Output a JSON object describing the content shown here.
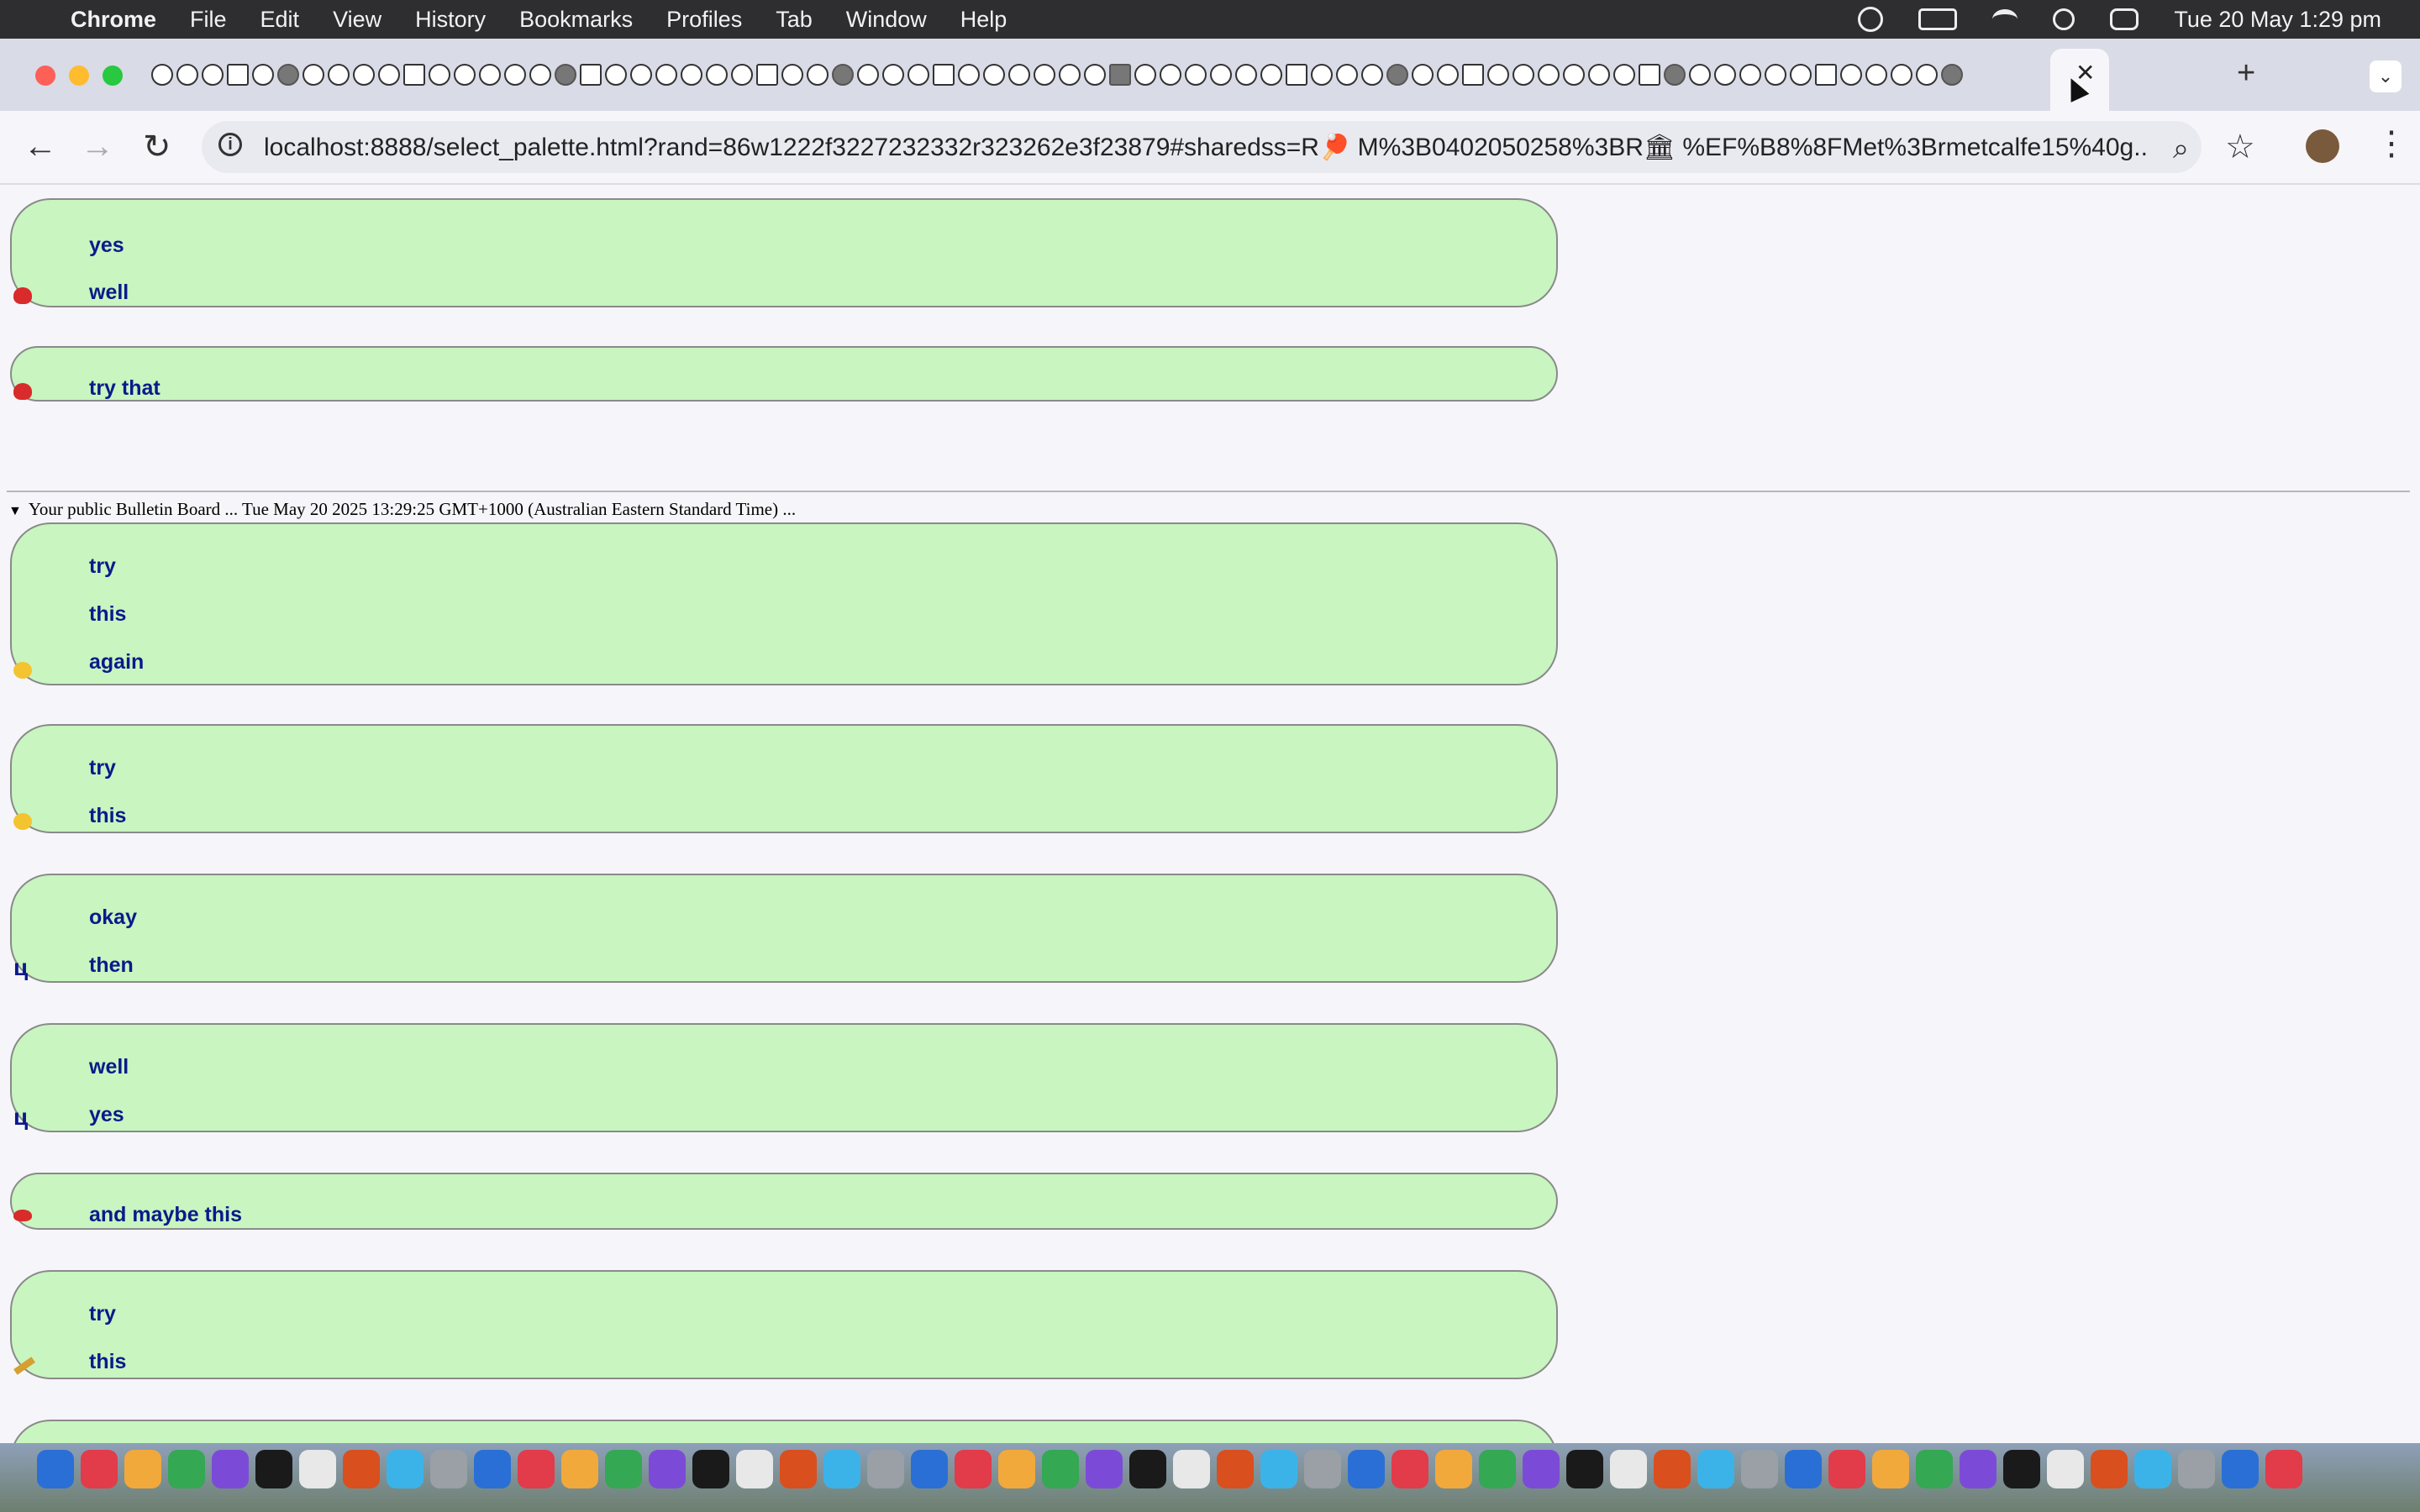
{
  "menubar": {
    "apple": "",
    "app": "Chrome",
    "items": [
      "File",
      "Edit",
      "View",
      "History",
      "Bookmarks",
      "Profiles",
      "Tab",
      "Window",
      "Help"
    ],
    "clock": "Tue 20 May  1:29 pm"
  },
  "tabstrip": {
    "close_glyph": "✕",
    "new_tab_glyph": "+",
    "tab_list_glyph": "⌄"
  },
  "toolbar": {
    "back": "←",
    "forward": "→",
    "reload": "↻",
    "info": "i",
    "url": "localhost:8888/select_palette.html?rand=86w1222f3227232332r323262e3f23879#sharedss=R🏓 M%3B0402050258%3BR🏛 %EF%B8%8FMet%3Brmetcalfe15%40g...",
    "zoom": "⌕",
    "star": "☆",
    "menu": "⋮"
  },
  "page": {
    "top_messages": [
      {
        "lines": [
          "yes",
          "well"
        ],
        "icon": "ping-pong-icon"
      },
      {
        "lines": [
          "try that"
        ],
        "icon": "ping-pong-icon"
      }
    ],
    "bulletin_header": "Your public Bulletin Board ... Tue May 20 2025 13:29:25 GMT+1000 (Australian Eastern Standard Time) ...",
    "bulletin_messages": [
      {
        "lines": [
          "try",
          "this",
          "again"
        ],
        "icon": "smiley-icon"
      },
      {
        "lines": [
          "try",
          "this"
        ],
        "icon": "smiley-icon"
      },
      {
        "lines": [
          "okay",
          "then"
        ],
        "icon": "tsa-glyph-icon",
        "glyph": "ц"
      },
      {
        "lines": [
          "well",
          "yes"
        ],
        "icon": "tsa-glyph-icon",
        "glyph": "ц"
      },
      {
        "lines": [
          "and maybe this"
        ],
        "icon": "mushroom-icon"
      },
      {
        "lines": [
          "try",
          "this"
        ],
        "icon": "cricket-bat-icon"
      }
    ]
  },
  "colors": {
    "message_bg": "#c8f5c0",
    "message_text": "#0a1a8a",
    "page_bg": "#f6f6fa"
  }
}
